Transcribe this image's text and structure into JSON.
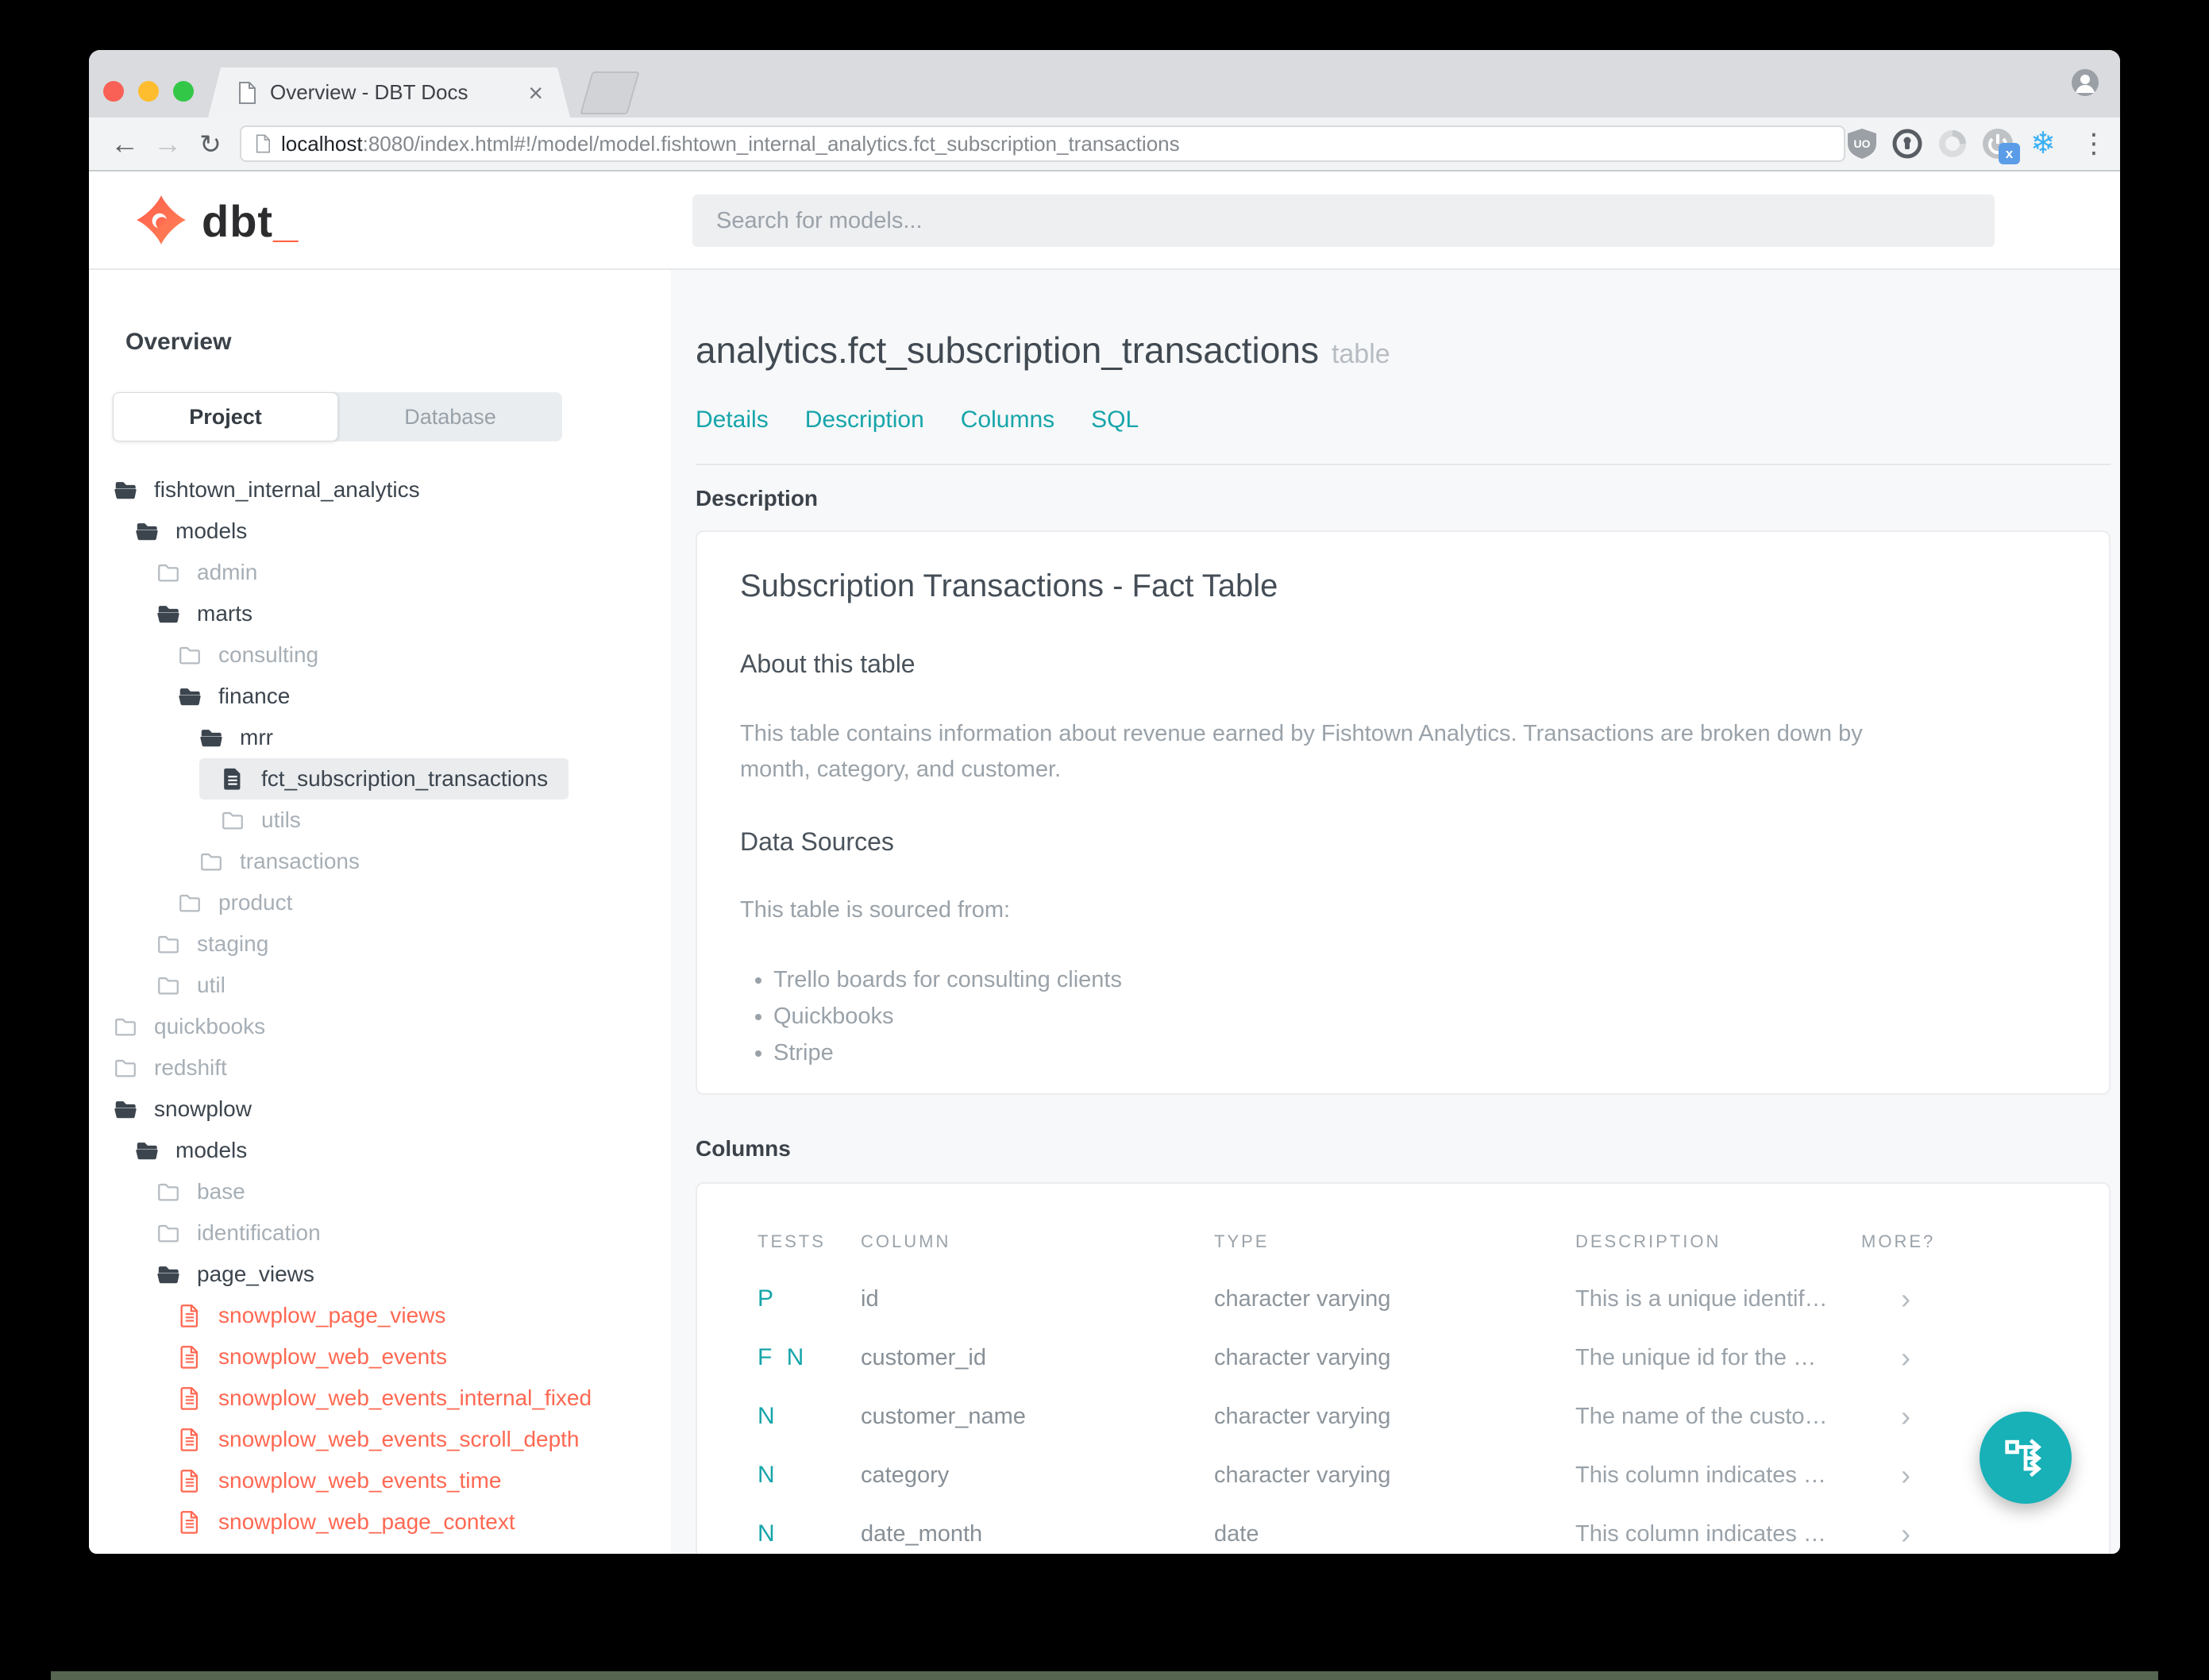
{
  "browser": {
    "tab_title": "Overview - DBT Docs",
    "close_symbol": "×",
    "back_symbol": "←",
    "forward_symbol": "→",
    "reload_symbol": "↻",
    "kebab_symbol": "⋮",
    "snowflake_symbol": "❄",
    "ext_badge_label": "x",
    "ublock_label": "UO",
    "url_host": "localhost",
    "url_rest": ":8080/index.html#!/model/model.fishtown_internal_analytics.fct_subscription_transactions"
  },
  "header": {
    "logo_text": "dbt",
    "logo_underscore": "_",
    "search_placeholder": "Search for models..."
  },
  "sidebar": {
    "title": "Overview",
    "tabs": [
      {
        "label": "Project",
        "active": true
      },
      {
        "label": "Database",
        "active": false
      }
    ],
    "tree": [
      {
        "label": "fishtown_internal_analytics",
        "depth": 0,
        "icon": "folder-open",
        "tone": "dark"
      },
      {
        "label": "models",
        "depth": 1,
        "icon": "folder-open",
        "tone": "dark"
      },
      {
        "label": "admin",
        "depth": 2,
        "icon": "folder",
        "tone": "muted"
      },
      {
        "label": "marts",
        "depth": 2,
        "icon": "folder-open",
        "tone": "dark"
      },
      {
        "label": "consulting",
        "depth": 3,
        "icon": "folder",
        "tone": "muted"
      },
      {
        "label": "finance",
        "depth": 3,
        "icon": "folder-open",
        "tone": "dark"
      },
      {
        "label": "mrr",
        "depth": 4,
        "icon": "folder-open",
        "tone": "dark"
      },
      {
        "label": "fct_subscription_transactions",
        "depth": 5,
        "icon": "file",
        "tone": "dark",
        "selected": true
      },
      {
        "label": "utils",
        "depth": 5,
        "icon": "folder",
        "tone": "muted"
      },
      {
        "label": "transactions",
        "depth": 4,
        "icon": "folder",
        "tone": "muted"
      },
      {
        "label": "product",
        "depth": 3,
        "icon": "folder",
        "tone": "muted"
      },
      {
        "label": "staging",
        "depth": 2,
        "icon": "folder",
        "tone": "muted"
      },
      {
        "label": "util",
        "depth": 2,
        "icon": "folder",
        "tone": "muted"
      },
      {
        "label": "quickbooks",
        "depth": 0,
        "icon": "folder",
        "tone": "muted"
      },
      {
        "label": "redshift",
        "depth": 0,
        "icon": "folder",
        "tone": "muted"
      },
      {
        "label": "snowplow",
        "depth": 0,
        "icon": "folder-open",
        "tone": "dark"
      },
      {
        "label": "models",
        "depth": 1,
        "icon": "folder-open",
        "tone": "dark"
      },
      {
        "label": "base",
        "depth": 2,
        "icon": "folder",
        "tone": "muted"
      },
      {
        "label": "identification",
        "depth": 2,
        "icon": "folder",
        "tone": "muted"
      },
      {
        "label": "page_views",
        "depth": 2,
        "icon": "folder-open",
        "tone": "dark"
      },
      {
        "label": "snowplow_page_views",
        "depth": 3,
        "icon": "file",
        "tone": "red"
      },
      {
        "label": "snowplow_web_events",
        "depth": 3,
        "icon": "file",
        "tone": "red"
      },
      {
        "label": "snowplow_web_events_internal_fixed",
        "depth": 3,
        "icon": "file",
        "tone": "red"
      },
      {
        "label": "snowplow_web_events_scroll_depth",
        "depth": 3,
        "icon": "file",
        "tone": "red"
      },
      {
        "label": "snowplow_web_events_time",
        "depth": 3,
        "icon": "file",
        "tone": "red"
      },
      {
        "label": "snowplow_web_page_context",
        "depth": 3,
        "icon": "file",
        "tone": "red"
      }
    ]
  },
  "main": {
    "title": "analytics.fct_subscription_transactions",
    "title_suffix": "table",
    "nav": [
      "Details",
      "Description",
      "Columns",
      "SQL"
    ],
    "description_section": {
      "heading": "Description",
      "card_title": "Subscription Transactions - Fact Table",
      "about_heading": "About this table",
      "about_text": "This table contains information about revenue earned by Fishtown Analytics. Transactions are broken down by month, category, and customer.",
      "sources_heading": "Data Sources",
      "sources_intro": "This table is sourced from:",
      "sources": [
        "Trello boards for consulting clients",
        "Quickbooks",
        "Stripe"
      ]
    },
    "columns_section": {
      "heading": "Columns",
      "table_headers": [
        "TESTS",
        "COLUMN",
        "TYPE",
        "DESCRIPTION",
        "MORE?"
      ],
      "chevron_symbol": "›",
      "rows": [
        {
          "tests": "P",
          "column": "id",
          "type": "character varying",
          "description": "This is a unique identif…"
        },
        {
          "tests": "F N",
          "column": "customer_id",
          "type": "character varying",
          "description": "The unique id for the …"
        },
        {
          "tests": "N",
          "column": "customer_name",
          "type": "character varying",
          "description": "The name of the custo…"
        },
        {
          "tests": "N",
          "column": "category",
          "type": "character varying",
          "description": "This column indicates …"
        },
        {
          "tests": "N",
          "column": "date_month",
          "type": "date",
          "description": "This column indicates …"
        }
      ]
    }
  },
  "colors": {
    "teal": "#16a5aa",
    "fab": "#17b1b7",
    "model_red": "#ff6852",
    "orange": "#ff6746",
    "traffic_red": "#f96157",
    "traffic_yellow": "#fdbd2e",
    "traffic_green": "#33c748",
    "snowflake": "#38b0f4",
    "badge_blue": "#5b9ce8"
  }
}
